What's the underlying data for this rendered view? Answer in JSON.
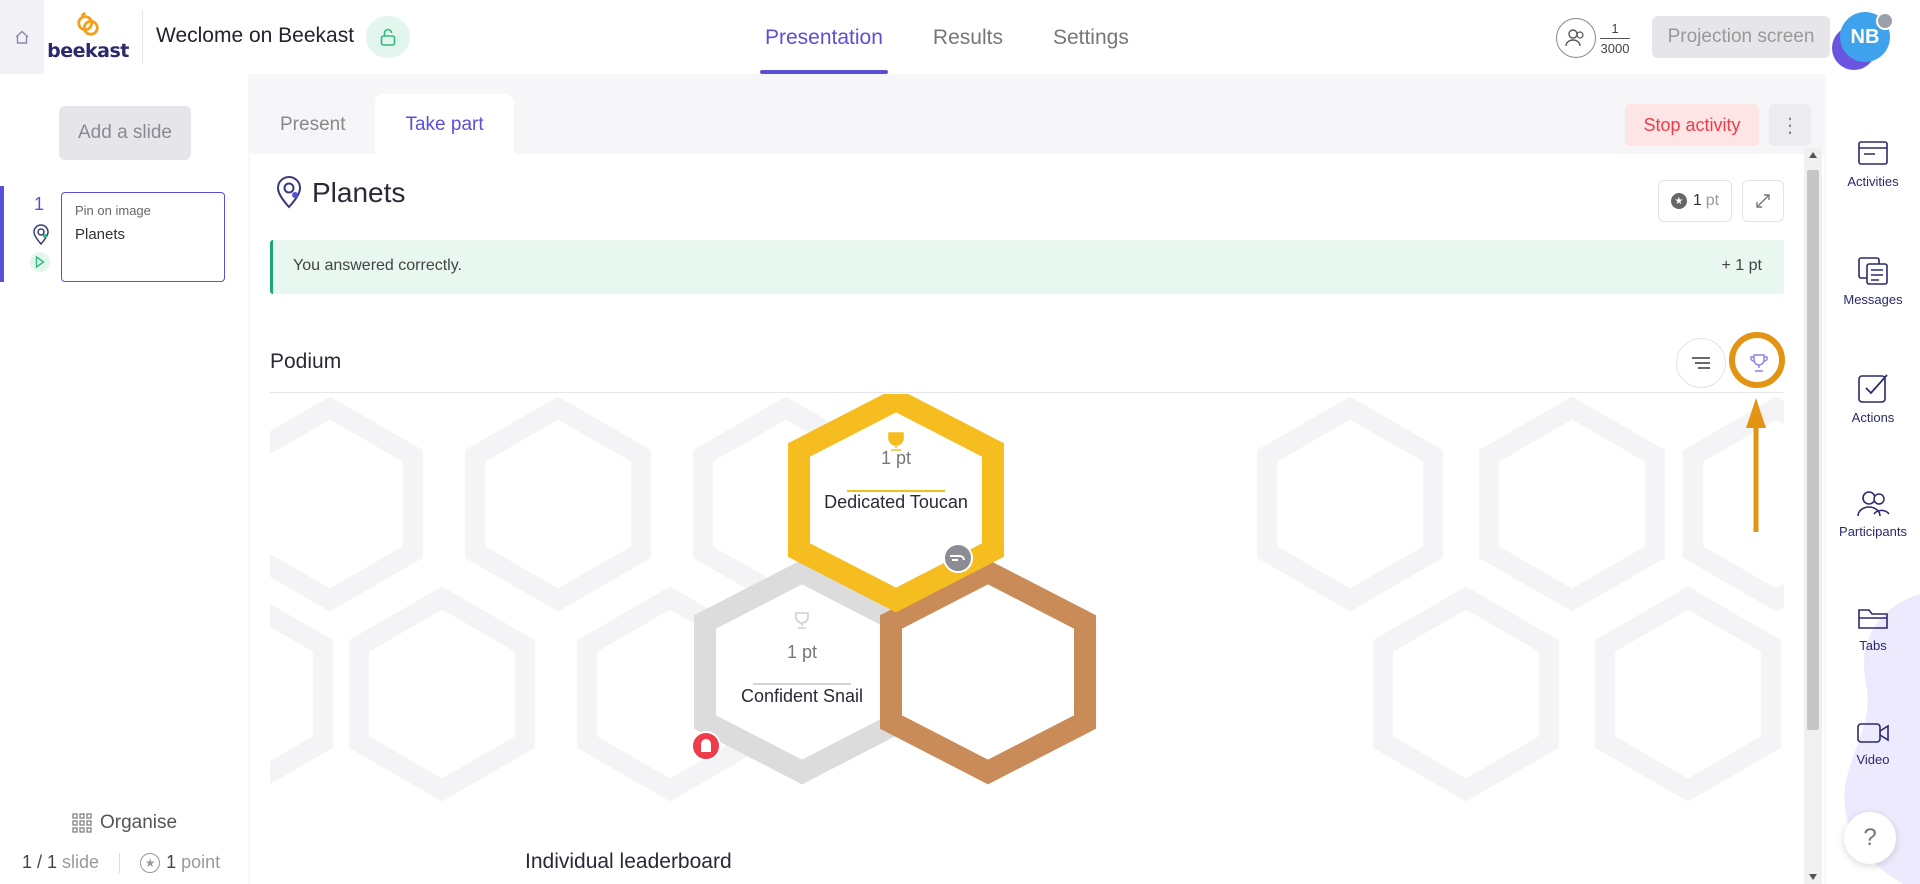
{
  "header": {
    "title": "Weclome on Beekast",
    "logo_text": "beekast",
    "tabs": [
      "Presentation",
      "Results",
      "Settings"
    ],
    "active_tab": "Presentation",
    "participants_current": "1",
    "participants_max": "3000",
    "projection_label": "Projection screen",
    "avatar_initials": "NB"
  },
  "sidebar": {
    "add_slide_label": "Add a slide",
    "slides": [
      {
        "number": "1",
        "type": "Pin on image",
        "name": "Planets"
      }
    ],
    "organise_label": "Organise",
    "slide_count": "1 / 1",
    "slide_word": "slide",
    "points_count": "1",
    "points_word": "point"
  },
  "panel": {
    "tabs": [
      "Present",
      "Take part"
    ],
    "active_tab": "Take part",
    "stop_label": "Stop activity",
    "activity_title": "Planets",
    "points_value": "1",
    "points_unit": "pt",
    "feedback_text": "You answered correctly.",
    "feedback_points": "+ 1 pt",
    "podium_label": "Podium",
    "leaderboard_label": "Individual leaderboard"
  },
  "podium": [
    {
      "rank": 1,
      "points": "1 pt",
      "name": "Dedicated Toucan",
      "color": "#f5bd1f"
    },
    {
      "rank": 2,
      "points": "1 pt",
      "name": "Confident Snail",
      "color": "#dcdcdc"
    },
    {
      "rank": 3,
      "points": "",
      "name": "",
      "color": "#c98b58"
    }
  ],
  "rightbar": {
    "items": [
      "Activities",
      "Messages",
      "Actions",
      "Participants",
      "Tabs",
      "Video"
    ],
    "help_label": "?"
  },
  "colors": {
    "accent": "#5a4fd8",
    "success": "#19a974",
    "danger": "#ee3d4a",
    "annotation": "#e39414"
  }
}
